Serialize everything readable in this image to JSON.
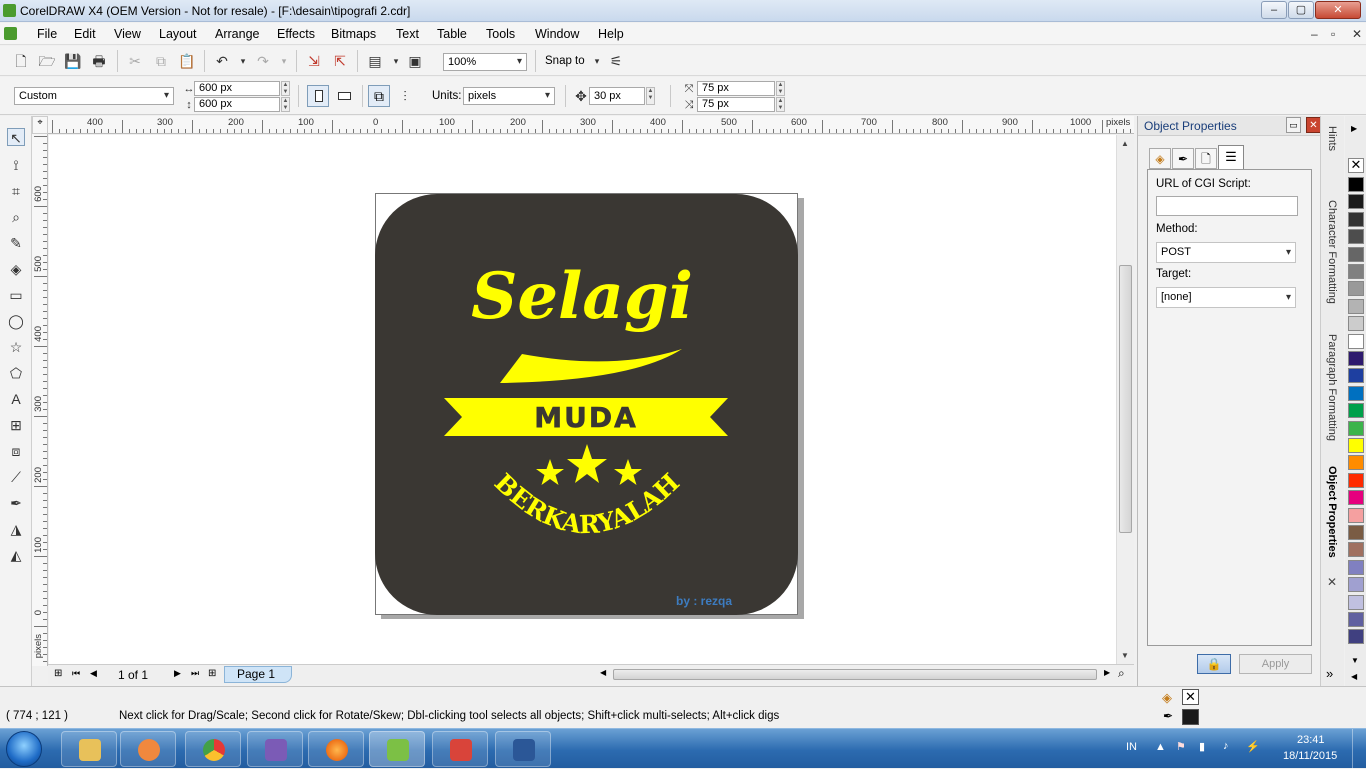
{
  "window": {
    "title": "CorelDRAW X4 (OEM Version - Not for resale) - [F:\\desain\\tipografi 2.cdr]",
    "min": "–",
    "max": "▢",
    "close": "✕"
  },
  "menu": [
    "File",
    "Edit",
    "View",
    "Layout",
    "Arrange",
    "Effects",
    "Bitmaps",
    "Text",
    "Table",
    "Tools",
    "Window",
    "Help"
  ],
  "toolbar": {
    "zoom": "100%",
    "snap_to": "Snap to"
  },
  "propbar": {
    "preset": "Custom",
    "width": "600 px",
    "height": "600 px",
    "units_label": "Units:",
    "units": "pixels",
    "nudge": "30 px",
    "dup_x": "75 px",
    "dup_y": "75 px"
  },
  "ruler": {
    "h": [
      "400",
      "300",
      "200",
      "100",
      "0",
      "100",
      "200",
      "300",
      "400",
      "500",
      "600",
      "700",
      "800",
      "900",
      "1000"
    ],
    "h_unit": "pixels",
    "v": [
      "600",
      "500",
      "400",
      "300",
      "200",
      "100",
      "0"
    ],
    "v_unit": "pixels"
  },
  "artwork": {
    "title": "Selagi",
    "banner": "MUDA",
    "arc": "BERKARYALAH",
    "credit": "by : rezqa",
    "bg": "#3a3733",
    "accent": "#ffff00"
  },
  "pagenav": {
    "count": "1 of 1",
    "tab": "Page 1"
  },
  "docker": {
    "title": "Object Properties",
    "url_label": "URL of CGI Script:",
    "url_value": "",
    "method_label": "Method:",
    "method_value": "POST",
    "target_label": "Target:",
    "target_value": "[none]",
    "apply": "Apply"
  },
  "docker_tabs": [
    "Hints",
    "Character Formatting",
    "Paragraph Formatting",
    "Object Properties"
  ],
  "palette": [
    "#000000",
    "#1a1a1a",
    "#333333",
    "#4d4d4d",
    "#666666",
    "#808080",
    "#999999",
    "#b3b3b3",
    "#cccccc",
    "#ffffff",
    "#2e1a6e",
    "#1e3fa0",
    "#0070c0",
    "#00a04a",
    "#3cb44b",
    "#ffff00",
    "#ff8c00",
    "#ff2a00",
    "#e6007e",
    "#f5a0a0",
    "#7a5c44",
    "#a07060",
    "#8080c0",
    "#a0a0d0",
    "#c0c0e0",
    "#6060a0",
    "#404080"
  ],
  "status": {
    "coords": "( 774  ;  121   )",
    "hint": "Next click for Drag/Scale; Second click for Rotate/Skew; Dbl-clicking tool selects all objects; Shift+click multi-selects; Alt+click digs"
  },
  "taskbar": {
    "lang": "IN",
    "time": "23:41",
    "date": "18/11/2015"
  }
}
